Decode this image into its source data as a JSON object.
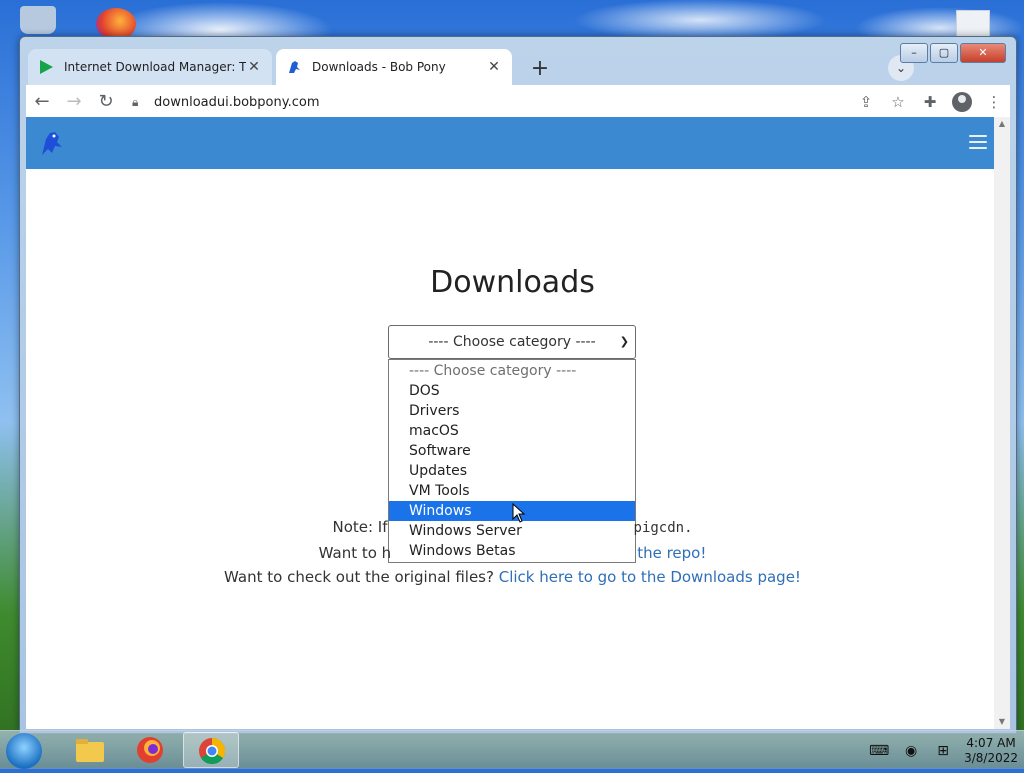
{
  "browser": {
    "tabs": [
      {
        "title": "Internet Download Manager: The",
        "active": false
      },
      {
        "title": "Downloads - Bob Pony",
        "active": true
      }
    ],
    "address": "downloadui.bobpony.com"
  },
  "page": {
    "title": "Downloads",
    "select": {
      "current": "---- Choose category ----",
      "options": [
        "---- Choose category ----",
        "DOS",
        "Drivers",
        "macOS",
        "Software",
        "Updates",
        "VM Tools",
        "Windows",
        "Windows Server",
        "Windows Betas"
      ],
      "highlighted": "Windows"
    },
    "notes": {
      "line1_prefix": "Note: If",
      "line1_suffix": "pigcdn.",
      "line2_prefix": "Want to h",
      "line2_link": "the repo!",
      "line3_text": "Want to check out the original files?",
      "line3_link": "Click here to go to the Downloads page!"
    }
  },
  "taskbar": {
    "time": "4:07 AM",
    "date": "3/8/2022"
  },
  "colors": {
    "navbar": "#3b8ad1",
    "link": "#2f6fb8",
    "highlight": "#1a73e8"
  }
}
